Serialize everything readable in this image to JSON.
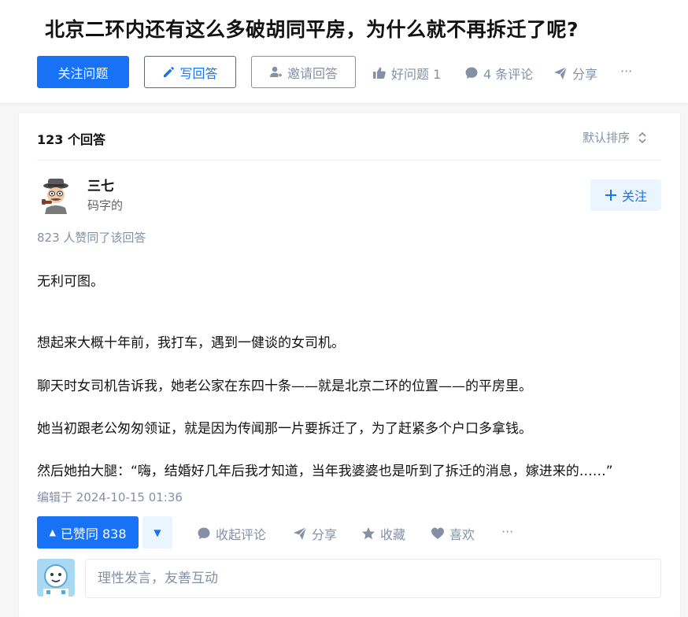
{
  "colors": {
    "accent": "#1772f6",
    "accent_light": "#ebf5ff",
    "muted": "#8590a6",
    "text": "#121212"
  },
  "question": {
    "title": "北京二环内还有这么多破胡同平房，为什么就不再拆迁了呢?",
    "follow_label": "关注问题",
    "write_label": "写回答",
    "invite_label": "邀请回答",
    "good_question_label": "好问题 1",
    "comments_label": "4 条评论",
    "share_label": "分享",
    "more_label": "···",
    "icons": {
      "write": "pencil-icon",
      "invite": "person-add-icon",
      "good": "thumbs-up-icon",
      "comment": "comment-bubble-icon",
      "share": "paper-plane-icon"
    }
  },
  "answers_header": {
    "count_label": "123 个回答",
    "sort_label": "默认排序",
    "sort_icon": "up-down-chevron-icon"
  },
  "answer": {
    "author": {
      "name": "三七",
      "bio": "码字的"
    },
    "follow_label": "关注",
    "votes_line": "823 人赞同了该回答",
    "paragraphs": [
      "无利可图。",
      "想起来大概十年前，我打车，遇到一健谈的女司机。",
      "聊天时女司机告诉我，她老公家在东四十条——就是北京二环的位置——的平房里。",
      "她当初跟老公匆匆领证，就是因为传闻那一片要拆迁了，为了赶紧多个户口多拿钱。",
      "然后她拍大腿：“嗨，结婚好几年后我才知道，当年我婆婆也是听到了拆迁的消息，嫁进来的……”"
    ],
    "edited": "编辑于 2024-10-15 01:36",
    "actions": {
      "upvote_label": "已赞同 838",
      "collapse_comments": "收起评论",
      "share": "分享",
      "favorite": "收藏",
      "like": "喜欢",
      "more": "···"
    }
  },
  "comment_box": {
    "placeholder": "理性发言，友善互动"
  }
}
